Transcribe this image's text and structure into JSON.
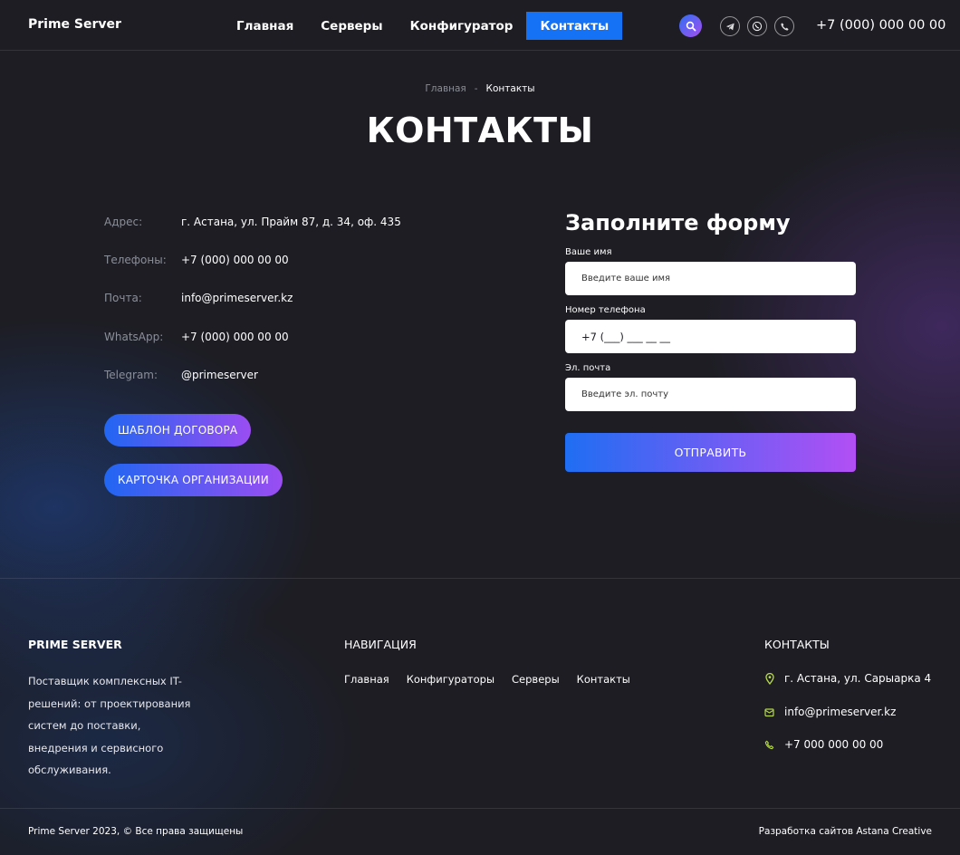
{
  "header": {
    "brand": "Prime Server",
    "nav": [
      "Главная",
      "Серверы",
      "Конфигуратор",
      "Контакты"
    ],
    "active_nav": "Контакты",
    "phone": "+7 (000) 000 00 00",
    "icons": [
      "search-icon",
      "telegram-icon",
      "whatsapp-icon",
      "phone-icon"
    ]
  },
  "breadcrumb": {
    "home": "Главная",
    "separator": "-",
    "current": "Контакты"
  },
  "page_title": "КОНТАКТЫ",
  "contacts": [
    {
      "label": "Адрес:",
      "value": "г. Астана, ул. Прайм 87, д. 34, оф. 435"
    },
    {
      "label": "Телефоны:",
      "value": "+7 (000) 000 00 00"
    },
    {
      "label": "Почта:",
      "value": "info@primeserver.kz"
    },
    {
      "label": "WhatsApp:",
      "value": "+7 (000) 000 00 00"
    },
    {
      "label": "Telegram:",
      "value": "@primeserver"
    }
  ],
  "buttons": {
    "contract": "ШАБЛОН ДОГОВОРА",
    "card": "КАРТОЧКА ОРГАНИЗАЦИИ"
  },
  "form": {
    "title": "Заполните форму",
    "name_label": "Ваше имя",
    "name_placeholder": "Введите ваше имя",
    "phone_label": "Номер телефона",
    "phone_value": "+7 (___) ___ __ __",
    "email_label": "Эл. почта",
    "email_placeholder": "Введите эл. почту",
    "submit": "ОТПРАВИТЬ"
  },
  "footer": {
    "brand": "PRIME SERVER",
    "about": "Поставщик комплексных IT-решений: от проектирования систем до поставки, внедрения и сервисного обслуживания.",
    "nav_title": "НАВИГАЦИЯ",
    "nav": [
      "Главная",
      "Конфигураторы",
      "Серверы",
      "Контакты"
    ],
    "contacts_title": "КОНТАКТЫ",
    "address": "г. Астана, ул. Сарыарка 4",
    "email": "info@primeserver.kz",
    "phone": "+7 000 000 00 00",
    "copyright": "Prime Server 2023, © Все права защищены",
    "credit": "Разработка сайтов Astana Creative"
  },
  "colors": {
    "accent": "#1572f5",
    "gradient_start": "#1f6ef3",
    "gradient_end": "#b24ff4",
    "footer_icon": "#b6d94a"
  }
}
